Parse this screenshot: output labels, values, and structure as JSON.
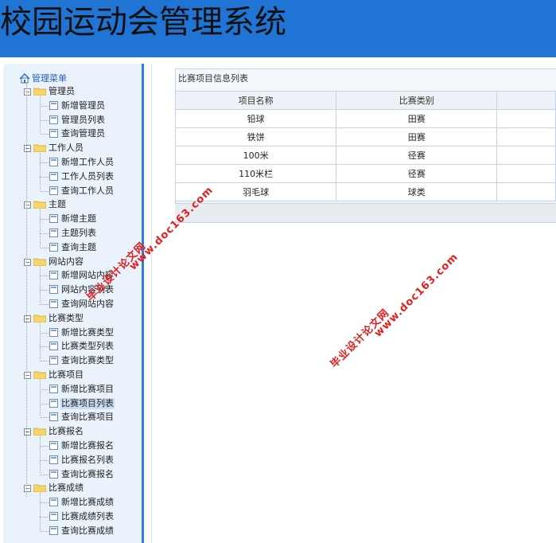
{
  "header": {
    "title": "校园运动会管理系统"
  },
  "sidebar": {
    "root_label": "管理菜单",
    "groups": [
      {
        "label": "管理员",
        "items": [
          "新增管理员",
          "管理员列表",
          "查询管理员"
        ]
      },
      {
        "label": "工作人员",
        "items": [
          "新增工作人员",
          "工作人员列表",
          "查询工作人员"
        ]
      },
      {
        "label": "主题",
        "items": [
          "新增主题",
          "主题列表",
          "查询主题"
        ]
      },
      {
        "label": "网站内容",
        "items": [
          "新增网站内容",
          "网站内容列表",
          "查询网站内容"
        ]
      },
      {
        "label": "比赛类型",
        "items": [
          "新增比赛类型",
          "比赛类型列表",
          "查询比赛类型"
        ]
      },
      {
        "label": "比赛项目",
        "items": [
          "新增比赛项目",
          "比赛项目列表",
          "查询比赛项目"
        ]
      },
      {
        "label": "比赛报名",
        "items": [
          "新增比赛报名",
          "比赛报名列表",
          "查询比赛报名"
        ]
      },
      {
        "label": "比赛成绩",
        "items": [
          "新增比赛成绩",
          "比赛成绩列表",
          "查询比赛成绩"
        ]
      }
    ],
    "selected_item": "比赛项目列表"
  },
  "main": {
    "panel_title": "比赛项目信息列表",
    "columns": [
      "项目名称",
      "比赛类别",
      ""
    ],
    "rows": [
      [
        "铅球",
        "田赛",
        ""
      ],
      [
        "铁饼",
        "田赛",
        ""
      ],
      [
        "100米",
        "径赛",
        ""
      ],
      [
        "110米栏",
        "径赛",
        ""
      ],
      [
        "羽毛球",
        "球类",
        ""
      ]
    ]
  },
  "watermarks": [
    {
      "line1": "毕业设计论文网",
      "line2": "www.doc163.com"
    },
    {
      "line1": "毕业设计论文网",
      "line2": "www.doc163.com"
    }
  ],
  "colors": {
    "header": "#1f74d4",
    "sidebar_border": "#2f7fd6",
    "watermark": "#e02020"
  }
}
